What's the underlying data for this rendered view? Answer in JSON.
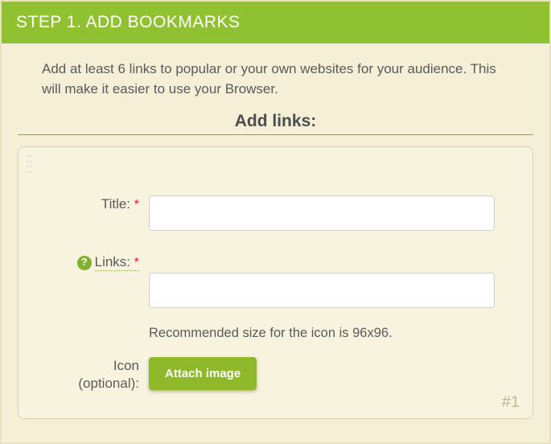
{
  "header": {
    "title": "STEP 1. ADD BOOKMARKS"
  },
  "intro": "Add at least 6 links to popular or your own websites for your audience. This will make it easier to use your Browser.",
  "section_title": "Add links:",
  "form": {
    "title_label": "Title:",
    "title_value": "",
    "links_label": "Links:",
    "links_value": "",
    "icon_label_line1": "Icon",
    "icon_label_line2": "(optional):",
    "icon_hint": "Recommended size for the icon is 96x96.",
    "attach_label": "Attach image",
    "required_marker": "*",
    "help_icon": "?"
  },
  "card_index": "#1"
}
